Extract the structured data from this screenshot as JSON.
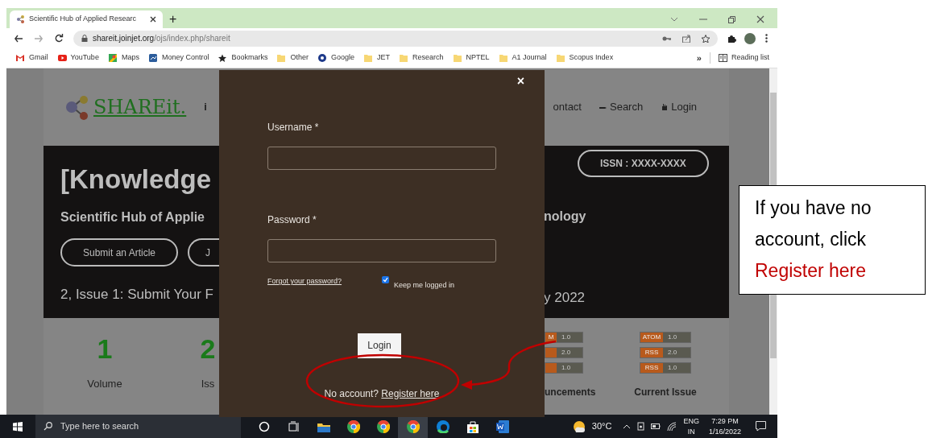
{
  "browser": {
    "tab": {
      "title": "Scientific Hub of Applied Researc",
      "selected": true
    },
    "new_tab": "+",
    "address": {
      "domain": "shareit.joinjet.org",
      "path": "/ojs/index.php/shareit"
    },
    "bookmarks": [
      {
        "label": "Gmail",
        "kind": "gmail"
      },
      {
        "label": "YouTube",
        "kind": "youtube"
      },
      {
        "label": "Maps",
        "kind": "maps"
      },
      {
        "label": "Money Control",
        "kind": "app"
      },
      {
        "label": "Bookmarks",
        "kind": "star"
      },
      {
        "label": "Other",
        "kind": "folder"
      },
      {
        "label": "Google",
        "kind": "jio"
      },
      {
        "label": "JET",
        "kind": "folder"
      },
      {
        "label": "Research",
        "kind": "folder"
      },
      {
        "label": "NPTEL",
        "kind": "folder"
      },
      {
        "label": "A1 Journal",
        "kind": "folder"
      },
      {
        "label": "Scopus Index",
        "kind": "folder"
      }
    ],
    "overflow": "»",
    "reading_list": "Reading list"
  },
  "page": {
    "logo": "SHAREit.",
    "nav_fragment": "i",
    "nav": [
      {
        "label": "ontact",
        "kind": "text"
      },
      {
        "label": "Search",
        "kind": "search"
      },
      {
        "label": "Login",
        "kind": "login"
      }
    ],
    "hero": {
      "title": "[Knowledge",
      "subtitle_left": "Scientific Hub of Applie",
      "subtitle_right": "nology",
      "buttons": [
        "Submit an Article",
        "J"
      ],
      "issn": "ISSN : XXXX-XXXX",
      "announce_left": "2, Issue 1: Submit Your F",
      "announce_right": "y 2022"
    },
    "stats": [
      {
        "value": "1",
        "label": "Volume"
      },
      {
        "value": "2",
        "label": "Iss"
      }
    ],
    "feeds": [
      {
        "label": "uncements",
        "badges": [
          {
            "tag": "M",
            "version": "1.0"
          },
          {
            "version": "2.0"
          },
          {
            "version": "1.0"
          }
        ]
      },
      {
        "label": "Current Issue",
        "badges": [
          {
            "tag": "ATOM",
            "version": "1.0"
          },
          {
            "tag": "RSS",
            "version": "2.0"
          },
          {
            "tag": "RSS",
            "version": "1.0"
          }
        ]
      }
    ]
  },
  "modal": {
    "close": "×",
    "username_label": "Username *",
    "password_label": "Password *",
    "forgot": "Forgot your password?",
    "remember": {
      "label": "Keep me logged in",
      "checked": true
    },
    "login": "Login",
    "register_prompt": "No account?",
    "register_link": "Register here"
  },
  "callout": {
    "text": "If you have no account, click",
    "link": "Register here"
  },
  "taskbar": {
    "search_placeholder": "Type here to search",
    "weather": "30°C",
    "lang": "ENG",
    "region": "IN",
    "time": "7:29 PM",
    "date": "1/16/2022"
  }
}
